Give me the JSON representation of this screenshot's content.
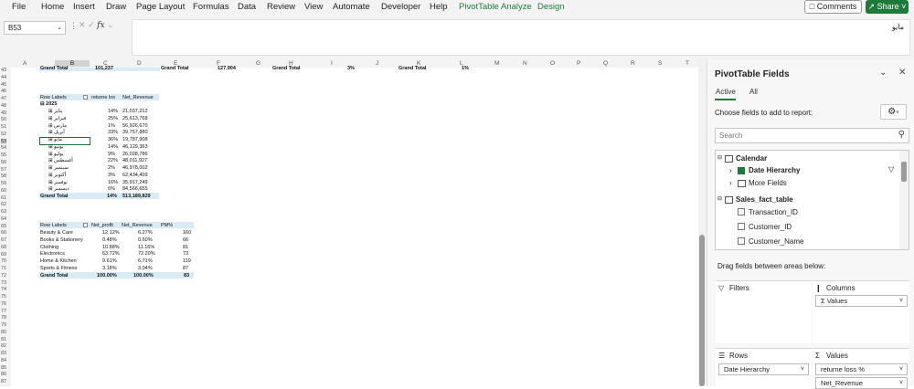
{
  "ribbon": {
    "tabs": [
      "File",
      "Home",
      "Insert",
      "Draw",
      "Page Layout",
      "Formulas",
      "Data",
      "Review",
      "View",
      "Automate",
      "Developer",
      "Help"
    ],
    "context_tabs": [
      "PivotTable Analyze",
      "Design"
    ],
    "comments_label": "Comments",
    "share_label": "Share",
    "accent_color": "#1e7a3c"
  },
  "formula_bar": {
    "name_box": "B53",
    "content": "مايو"
  },
  "sheet": {
    "columns": [
      "A",
      "B",
      "C",
      "D",
      "E",
      "F",
      "G",
      "H",
      "I",
      "J",
      "K",
      "L",
      "M",
      "N",
      "O",
      "P",
      "Q",
      "R",
      "S",
      "T"
    ],
    "selected_column": "B",
    "rows": [
      "43",
      "44",
      "45",
      "46",
      "47",
      "48",
      "49",
      "50",
      "51",
      "52",
      "53",
      "54",
      "55",
      "56",
      "57",
      "58",
      "59",
      "60",
      "61",
      "62",
      "63",
      "64",
      "65",
      "66",
      "67",
      "68",
      "69",
      "70",
      "71",
      "72",
      "73",
      "74",
      "75",
      "76",
      "77",
      "78",
      "79",
      "80",
      "81",
      "82",
      "83",
      "84",
      "85",
      "86",
      "87"
    ],
    "selected_row": "53",
    "row43": {
      "c1": "Grand Total",
      "c2": "101,237",
      "c3": "Grand Total",
      "c4": "127,904",
      "c5": "Grand Total",
      "c6": "3%",
      "c7": "Grand Total",
      "c8": "1%"
    },
    "pivot1": {
      "headers": [
        "Row Labels",
        "returne los",
        "Net_Revenue"
      ],
      "year": "2025",
      "rows": [
        {
          "month": "يناير",
          "pct": "14%",
          "rev": "21,037,212"
        },
        {
          "month": "فبراير",
          "pct": "25%",
          "rev": "25,613,768"
        },
        {
          "month": "مارس",
          "pct": "1%",
          "rev": "56,926,670"
        },
        {
          "month": "أبريل",
          "pct": "33%",
          "rev": "39,757,880"
        },
        {
          "month": "مايو",
          "pct": "36%",
          "rev": "19,787,908"
        },
        {
          "month": "يونيو",
          "pct": "14%",
          "rev": "46,129,363"
        },
        {
          "month": "يوليو",
          "pct": "9%",
          "rev": "26,028,786"
        },
        {
          "month": "أغسطس",
          "pct": "22%",
          "rev": "48,011,927"
        },
        {
          "month": "سبتمبر",
          "pct": "2%",
          "rev": "46,978,002"
        },
        {
          "month": "أكتوبر",
          "pct": "3%",
          "rev": "62,434,409"
        },
        {
          "month": "نوفمبر",
          "pct": "16%",
          "rev": "35,917,249"
        },
        {
          "month": "ديسمبر",
          "pct": "6%",
          "rev": "84,566,655"
        }
      ],
      "total": {
        "label": "Grand Total",
        "pct": "14%",
        "rev": "513,189,829"
      }
    },
    "pivot2": {
      "headers": [
        "Row Labels",
        "Net_profit",
        "Net_Revenue",
        "PM%"
      ],
      "rows": [
        {
          "cat": "Beauty & Care",
          "profit": "12.12%",
          "rev": "6.27%",
          "pm": "160"
        },
        {
          "cat": "Books & Stationery",
          "profit": "0.48%",
          "rev": "0.60%",
          "pm": "66"
        },
        {
          "cat": "Clothing",
          "profit": "10.88%",
          "rev": "11.16%",
          "pm": "81"
        },
        {
          "cat": "Electronics",
          "profit": "63.72%",
          "rev": "72.20%",
          "pm": "73"
        },
        {
          "cat": "Home & Kitchen",
          "profit": "9.61%",
          "rev": "6.71%",
          "pm": "119"
        },
        {
          "cat": "Sports & Fitness",
          "profit": "3.18%",
          "rev": "3.04%",
          "pm": "87"
        }
      ],
      "total": {
        "label": "Grand Total",
        "profit": "100.00%",
        "rev": "100.00%",
        "pm": "83"
      }
    }
  },
  "panel": {
    "title": "PivotTable Fields",
    "tabs": [
      "Active",
      "All"
    ],
    "choose_label": "Choose fields to add to report:",
    "search_placeholder": "Search",
    "fields": {
      "calendar": "Calendar",
      "date_hierarchy": "Date Hierarchy",
      "more_fields": "More Fields",
      "sales_table": "Sales_fact_table",
      "transaction_id": "Transaction_ID",
      "customer_id": "Customer_ID",
      "customer_name": "Customer_Name"
    },
    "drag_label": "Drag fields between areas below:",
    "areas": {
      "filters": "Filters",
      "columns": "Columns",
      "rows": "Rows",
      "values": "Values"
    },
    "columns_items": [
      "Σ Values"
    ],
    "rows_items": [
      "Date Hierarchy"
    ],
    "values_items": [
      "returne loss %",
      "Net_Revenue"
    ]
  }
}
